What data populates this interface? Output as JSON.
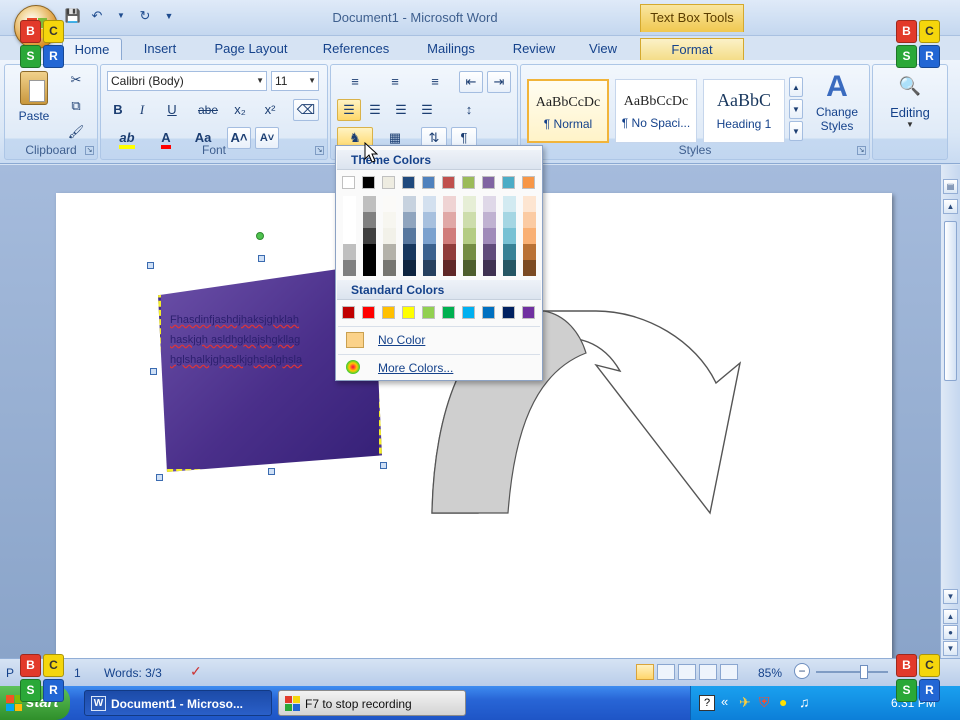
{
  "window": {
    "title": "Document1 - Microsoft Word",
    "contextual_tab": "Text Box Tools"
  },
  "tabs": [
    {
      "label": "Home",
      "active": true
    },
    {
      "label": "Insert"
    },
    {
      "label": "Page Layout"
    },
    {
      "label": "References"
    },
    {
      "label": "Mailings"
    },
    {
      "label": "Review"
    },
    {
      "label": "View"
    },
    {
      "label": "Format"
    }
  ],
  "ribbon": {
    "clipboard": {
      "label": "Clipboard",
      "paste": "Paste"
    },
    "font": {
      "label": "Font",
      "font_name": "Calibri (Body)",
      "font_size": "11",
      "bold": "B",
      "italic": "I",
      "underline": "U",
      "strike": "abe",
      "subscript": "x₂",
      "superscript": "x²",
      "highlight": "ab",
      "font_color": "A",
      "change_case": "Aa",
      "grow": "A˄",
      "shrink": "A˅"
    },
    "styles": {
      "label": "Styles",
      "tiles": [
        {
          "sample": "AaBbCcDc",
          "name": "¶ Normal",
          "selected": true
        },
        {
          "sample": "AaBbCcDc",
          "name": "¶ No Spaci..."
        },
        {
          "sample": "AaBbC",
          "name": "Heading 1"
        }
      ],
      "change_styles": "Change Styles"
    },
    "editing": {
      "label": "Editing"
    }
  },
  "color_panel": {
    "theme_header": "Theme Colors",
    "standard_header": "Standard Colors",
    "no_color": "No Color",
    "more_colors": "More Colors...",
    "theme_colors": [
      "#ffffff",
      "#000000",
      "#eeece1",
      "#1f497d",
      "#4f81bd",
      "#c0504d",
      "#9bbb59",
      "#8064a2",
      "#4bacc6",
      "#f79646"
    ],
    "standard_colors": [
      "#c00000",
      "#ff0000",
      "#ffc000",
      "#ffff00",
      "#92d050",
      "#00b050",
      "#00b0f0",
      "#0070c0",
      "#002060",
      "#7030a0"
    ]
  },
  "document": {
    "textbox_lines": [
      "Fhasdinfjashdjhaksjghklah",
      "haskjgh asldhgklajshgkllag",
      "hglshalkjghaslkjghslalghsla"
    ]
  },
  "status": {
    "page": "P",
    "page_num": "1",
    "words": "Words: 3/3",
    "zoom": "85%"
  },
  "taskbar": {
    "start": "start",
    "tasks": [
      {
        "label": "Document1 - Microso..."
      },
      {
        "label": "F7 to stop recording"
      }
    ],
    "clock": "6:31 PM"
  },
  "logo": {
    "letters": [
      "B",
      "C",
      "S",
      "R"
    ],
    "colors": [
      "#e23a2a",
      "#f5d60c",
      "#2aa838",
      "#2266d4"
    ]
  }
}
